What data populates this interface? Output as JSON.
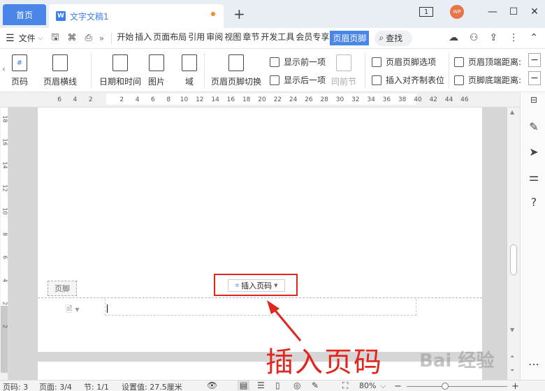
{
  "tabs": {
    "home": "首页",
    "doc_title": "文字文稿1",
    "doc_icon": "W",
    "add": "+"
  },
  "window": {
    "badge": "1",
    "avatar": "WP",
    "minimize": "—",
    "maximize": "☐",
    "close": "✕"
  },
  "menubar": {
    "file": "文件",
    "more": "»",
    "tabs": [
      "开始",
      "插入",
      "页面布局",
      "引用",
      "审阅",
      "视图",
      "章节",
      "开发工具",
      "会员专享",
      "页眉页脚"
    ],
    "active_tab": "页眉页脚",
    "search": "查找"
  },
  "ribbon": {
    "page_number": "页码",
    "header_line": "页眉横线",
    "datetime": "日期和时间",
    "picture": "图片",
    "field": "域",
    "switch": "页眉页脚切换",
    "show_prev": "显示前一项",
    "show_next": "显示后一项",
    "same_as_prev": "同前节",
    "options": "页眉页脚选项",
    "insert_tab": "插入对齐制表位",
    "header_top": "页眉顶端距离:",
    "footer_bottom": "页脚底端距离:",
    "minus": "−"
  },
  "ruler": {
    "numbers": [
      "6",
      "4",
      "2",
      "2",
      "4",
      "6",
      "8",
      "10",
      "12",
      "14",
      "16",
      "18",
      "20",
      "22",
      "24",
      "26",
      "28",
      "30",
      "32",
      "34",
      "36",
      "38",
      "40",
      "42",
      "44",
      "46"
    ],
    "vnumbers": [
      "18",
      "16",
      "14",
      "12",
      "10",
      "8",
      "6",
      "4",
      "2",
      "2"
    ]
  },
  "document": {
    "footer_label": "页脚",
    "insert_page_number": "插入页码",
    "annotation": "插入页码",
    "watermark": "Bai 经验"
  },
  "statusbar": {
    "page_num": "页码: 3",
    "pages": "页面: 3/4",
    "section": "节: 1/1",
    "setting": "设置值: 27.5厘米",
    "zoom": "80%",
    "zoom_minus": "−",
    "zoom_plus": "+"
  },
  "colors": {
    "accent": "#4a86e8",
    "annotation": "#e0261f"
  }
}
